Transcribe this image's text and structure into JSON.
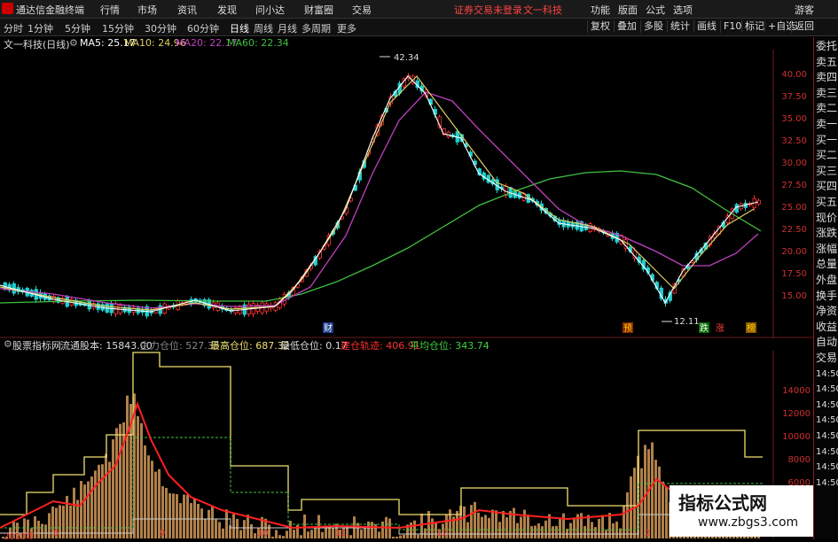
{
  "menubar": {
    "app_title": "通达信金融终端",
    "items": [
      "行情",
      "市场",
      "资讯",
      "发现",
      "问小达",
      "财富圈",
      "交易"
    ],
    "warning": "证券交易未登录",
    "stock": "文一科技",
    "right_items": [
      "功能",
      "版面",
      "公式",
      "选项"
    ],
    "guest": "游客"
  },
  "toolbar": {
    "periods": [
      "分时",
      "1分钟",
      "5分钟",
      "15分钟",
      "30分钟",
      "60分钟",
      "日线",
      "周线",
      "月线",
      "多周期",
      "更多"
    ],
    "active_period": "日线",
    "buttons": [
      "复权",
      "叠加",
      "多股",
      "统计",
      "画线",
      "F10",
      "标记",
      "+自选",
      "返回"
    ]
  },
  "kline_header": {
    "name": "文一科技(日线)",
    "ma5": "MA5: 25.17",
    "ma10": "MA10: 24.96",
    "ma20": "MA20: 22.17",
    "ma60": "MA60: 22.34"
  },
  "kline_axis": [
    "40.00",
    "37.50",
    "35.00",
    "32.50",
    "30.00",
    "27.50",
    "25.00",
    "22.50",
    "20.00",
    "17.50",
    "15.00"
  ],
  "annotations": {
    "high": "42.34",
    "low": "12.11",
    "markers": [
      "财",
      "预",
      "跌",
      "涨",
      "榜"
    ]
  },
  "indicator_header": {
    "name": "股票指标网",
    "float": "流通股本: 15843.00",
    "main": "主力仓位: 527.35",
    "highest": "最高仓位: 687.32",
    "lowest": "最低仓位: 0.17",
    "build": "建仓轨迹: 406.91",
    "avg": "平均仓位: 343.74"
  },
  "indicator_axis": [
    "14000",
    "12000",
    "10000",
    "8000",
    "6000",
    "4000",
    "2000"
  ],
  "x_labels": [
    "2023年",
    "8",
    "9",
    "10",
    "11",
    "12",
    "2"
  ],
  "right_panel": [
    "委托",
    "卖五",
    "卖四",
    "卖三",
    "卖二",
    "卖一",
    "买一",
    "买二",
    "买三",
    "买四",
    "买五",
    "现价",
    "涨跌",
    "涨幅",
    "总量",
    "外盘",
    "换手",
    "净资",
    "收益",
    "自动",
    "交易",
    "14:50",
    "14:50",
    "14:50",
    "14:50",
    "14:50",
    "14:50",
    "14:50",
    "14:50"
  ],
  "watermark": {
    "line1": "指标公式网",
    "line2": "www.zbgs3.com"
  },
  "colors": {
    "ma5": "#ffffff",
    "ma10": "#e0d060",
    "ma20": "#c040c0",
    "ma60": "#40c040",
    "up": "#ff3030",
    "down": "#20d0d0",
    "accent": "#ff4444"
  }
}
